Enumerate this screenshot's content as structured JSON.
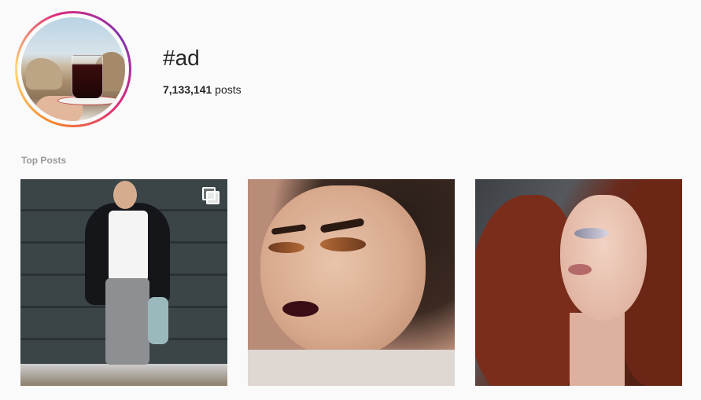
{
  "header": {
    "hashtag": "#ad",
    "post_count": "7,133,141",
    "post_count_suffix": " posts"
  },
  "section": {
    "label": "Top Posts"
  },
  "posts": [
    {
      "kind": "carousel",
      "icon": "multiple-images-icon"
    },
    {
      "kind": "photo"
    },
    {
      "kind": "photo"
    }
  ],
  "colors": {
    "background": "#fafafa",
    "text": "#262626",
    "section_label": "#999999",
    "story_ring": [
      "#f58529",
      "#dd2a7b",
      "#8134af"
    ]
  }
}
